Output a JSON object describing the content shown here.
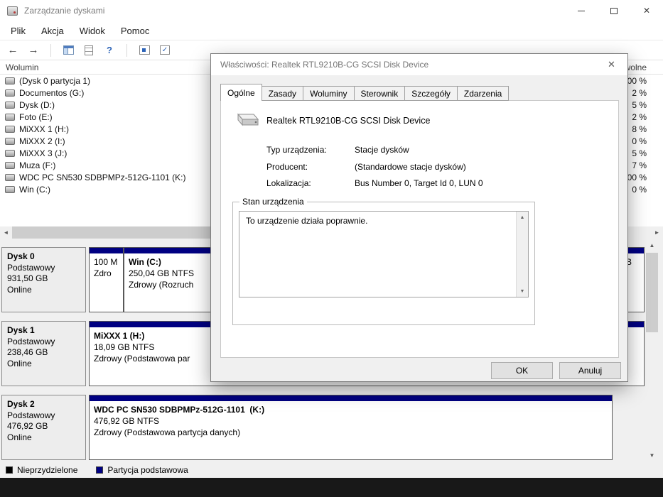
{
  "window": {
    "title": "Zarządzanie dyskami"
  },
  "menu": {
    "items": [
      "Plik",
      "Akcja",
      "Widok",
      "Pomoc"
    ]
  },
  "toolbar": {
    "icons": [
      "back",
      "forward",
      "console-tree",
      "export-list",
      "help",
      "action-pane",
      "properties"
    ]
  },
  "glyphs": {
    "close": "✕",
    "back": "←",
    "forward": "→",
    "help": "?",
    "check": "✓",
    "scroll_up": "▲",
    "scroll_down": "▼",
    "scroll_left": "◄",
    "scroll_right": "►"
  },
  "colors": {
    "partition_primary": "#000082",
    "unallocated": "#000000"
  },
  "volume_list": {
    "header": {
      "volume": "Wolumin",
      "free_pct": "wolne"
    },
    "rows": [
      {
        "name": "(Dysk 0 partycja 1)",
        "free": "00 %"
      },
      {
        "name": "Documentos (G:)",
        "free": "2 %"
      },
      {
        "name": "Dysk (D:)",
        "free": "5 %"
      },
      {
        "name": "Foto (E:)",
        "free": "2 %"
      },
      {
        "name": "MiXXX 1 (H:)",
        "free": "8 %"
      },
      {
        "name": "MiXXX 2 (I:)",
        "free": "0 %"
      },
      {
        "name": "MiXXX 3 (J:)",
        "free": "5 %"
      },
      {
        "name": "Muza (F:)",
        "free": "7 %"
      },
      {
        "name": "WDC PC SN530 SDBPMPz-512G-1101 (K:)",
        "free": "00 %"
      },
      {
        "name": "Win (C:)",
        "free": "0 %"
      }
    ]
  },
  "disks": [
    {
      "name": "Dysk 0",
      "type": "Podstawowy",
      "size": "931,50 GB",
      "status": "Online",
      "partitions": [
        {
          "l1": "",
          "l2": "100 M",
          "l3": "Zdro"
        },
        {
          "l1": "Win (C:)",
          "l2": "250,04 GB NTFS",
          "l3": "Zdrowy (Rozruch"
        },
        {
          "l1": "",
          "l2": "B",
          "l3": ""
        }
      ]
    },
    {
      "name": "Dysk 1",
      "type": "Podstawowy",
      "size": "238,46 GB",
      "status": "Online",
      "partitions": [
        {
          "l1": "MiXXX 1 (H:)",
          "l2": "18,09 GB NTFS",
          "l3": "Zdrowy (Podstawowa par"
        }
      ]
    },
    {
      "name": "Dysk 2",
      "type": "Podstawowy",
      "size": "476,92 GB",
      "status": "Online",
      "partitions": [
        {
          "l1": "WDC PC SN530 SDBPMPz-512G-1101  (K:)",
          "l2": "476,92 GB NTFS",
          "l3": "Zdrowy (Podstawowa partycja danych)"
        }
      ]
    }
  ],
  "legend": {
    "items": [
      {
        "label": "Nieprzydzielone",
        "color": "#000000"
      },
      {
        "label": "Partycja podstawowa",
        "color": "#000082"
      }
    ]
  },
  "dialog": {
    "title": "Właściwości: Realtek RTL9210B-CG SCSI Disk Device",
    "tabs": [
      "Ogólne",
      "Zasady",
      "Woluminy",
      "Sterownik",
      "Szczegóły",
      "Zdarzenia"
    ],
    "active_tab": "Ogólne",
    "device_name": "Realtek RTL9210B-CG SCSI Disk Device",
    "fields": [
      {
        "label": "Typ urządzenia:",
        "value": "Stacje dysków"
      },
      {
        "label": "Producent:",
        "value": "(Standardowe stacje dysków)"
      },
      {
        "label": "Lokalizacja:",
        "value": "Bus Number 0, Target Id 0, LUN 0"
      }
    ],
    "device_status": {
      "group_label": "Stan urządzenia",
      "text": "To urządzenie działa poprawnie."
    },
    "buttons": {
      "ok": "OK",
      "cancel": "Anuluj"
    }
  }
}
